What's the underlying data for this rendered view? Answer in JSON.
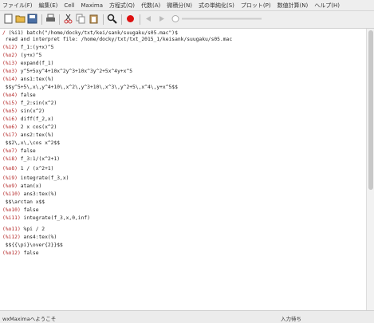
{
  "menu": [
    "ファイル(F)",
    "編集(E)",
    "Cell",
    "Maxima",
    "方程式(Q)",
    "代数(A)",
    "微積分(N)",
    "式の単純化(S)",
    "プロット(P)",
    "数値計算(N)",
    "ヘルプ(H)"
  ],
  "icons": [
    "new-file-icon",
    "open-file-icon",
    "save-icon",
    "print-icon",
    "cut-icon",
    "copy-icon",
    "paste-icon",
    "find-icon",
    "interrupt-icon",
    "animation-back-icon",
    "animation-play-icon",
    "animation-slider-icon"
  ],
  "lines": [
    {
      "label": "/",
      "text": "(%i1) batch(\"/home/docky/txt/kei/sank/suugaku/s05.mac\")$"
    },
    {
      "label": "",
      "text": "read and interpret file: /home/docky/txt/txt_2015_1/keisank/suugaku/s05.mac"
    },
    {
      "label": "(%i2)",
      "text": "f_1:(y+x)^5"
    },
    {
      "label": "(%o2)",
      "text": "(y+x)^5"
    },
    {
      "label": "(%i3)",
      "text": "expand(f_1)"
    },
    {
      "label": "(%o3)",
      "text": "y^5+5xy^4+10x^2y^3+10x^3y^2+5x^4y+x^5"
    },
    {
      "label": "(%i4)",
      "text": "ans1:tex(%)"
    },
    {
      "label": "",
      "text": "$$y^5+5\\,x\\,y^4+10\\,x^2\\,y^3+10\\,x^3\\,y^2+5\\,x^4\\,y+x^5$$"
    },
    {
      "label": "(%o4)",
      "text": "false"
    },
    {
      "label": "(%i5)",
      "text": "f_2:sin(x^2)"
    },
    {
      "label": "(%o5)",
      "text": "sin(x^2)"
    },
    {
      "label": "(%i6)",
      "text": "diff(f_2,x)"
    },
    {
      "label": "(%o6)",
      "text": "2 x cos(x^2)"
    },
    {
      "label": "(%i7)",
      "text": "ans2:tex(%)"
    },
    {
      "label": "",
      "text": "$$2\\,x\\,\\cos x^2$$"
    },
    {
      "label": "(%o7)",
      "text": "false"
    },
    {
      "label": "(%i8)",
      "text": "f_3:1/(x^2+1)"
    },
    {
      "label": "(%o8)",
      "text": "1 / (x^2+1)"
    },
    {
      "label": "(%i9)",
      "text": "integrate(f_3,x)"
    },
    {
      "label": "(%o9)",
      "text": "atan(x)"
    },
    {
      "label": "(%i10)",
      "text": "ans3:tex(%)"
    },
    {
      "label": "",
      "text": "$$\\arctan x$$"
    },
    {
      "label": "(%o10)",
      "text": "false"
    },
    {
      "label": "(%i11)",
      "text": "integrate(f_3,x,0,inf)"
    },
    {
      "label": "(%o11)",
      "text": "%pi / 2"
    },
    {
      "label": "(%i12)",
      "text": "ans4:tex(%)"
    },
    {
      "label": "",
      "text": "$${{\\pi}\\over{2}}$$"
    },
    {
      "label": "(%o12)",
      "text": "false"
    }
  ],
  "status": {
    "left": "wxMaximaへようこそ",
    "right": "入力待ち"
  }
}
